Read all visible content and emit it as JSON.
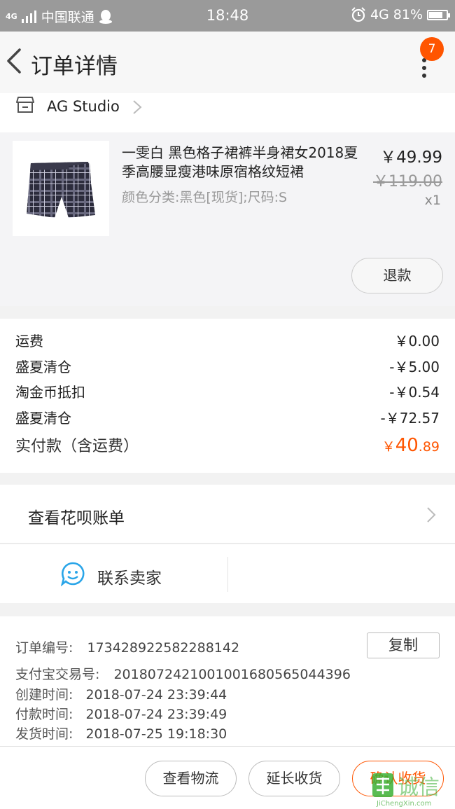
{
  "status_bar": {
    "network": "4G",
    "carrier": "中国联通",
    "time": "18:48",
    "network_right": "4G",
    "battery": "81%",
    "battery_level": 0.81
  },
  "header": {
    "title": "订单详情",
    "badge_count": "7"
  },
  "shop": {
    "name": "AG  Studio"
  },
  "product": {
    "title": "一雯白 黑色格子裙裤半身裙女2018夏季高腰显瘦港味原宿格纹短裙",
    "spec": "颜色分类:黑色[现货];尺码:S",
    "price": "￥49.99",
    "original_price": "￥119.00",
    "quantity": "x1",
    "refund_label": "退款"
  },
  "fees": {
    "rows": [
      {
        "label": "运费",
        "value": "￥0.00"
      },
      {
        "label": "盛夏清仓",
        "value": "-￥5.00"
      },
      {
        "label": "淘金币抵扣",
        "value": "-￥0.54"
      },
      {
        "label": "盛夏清仓",
        "value": "-￥72.57"
      }
    ],
    "total_label": "实付款（含运费）",
    "total_symbol": "￥",
    "total_int": "40",
    "total_dec": ".89"
  },
  "bill": {
    "label": "查看花呗账单"
  },
  "contact": {
    "label": "联系卖家"
  },
  "order_info": {
    "order_no_label": "订单编号:",
    "order_no": "173428922582288142",
    "copy_label": "复制",
    "alipay_label": "支付宝交易号:",
    "alipay_no": "2018072421001001680565044396",
    "created_label": "创建时间:",
    "created": "2018-07-24 23:39:44",
    "paid_label": "付款时间:",
    "paid": "2018-07-24 23:39:49",
    "shipped_label": "发货时间:",
    "shipped": "2018-07-25 19:18:30"
  },
  "actions": {
    "logistics": "查看物流",
    "extend": "延长收货",
    "confirm": "确认收货"
  },
  "watermark": {
    "text": "集诚信",
    "sub": "JiChengXin.com"
  },
  "colors": {
    "accent": "#ff5500",
    "status_bar": "#9a9a9a",
    "watermark": "#3cb035"
  }
}
